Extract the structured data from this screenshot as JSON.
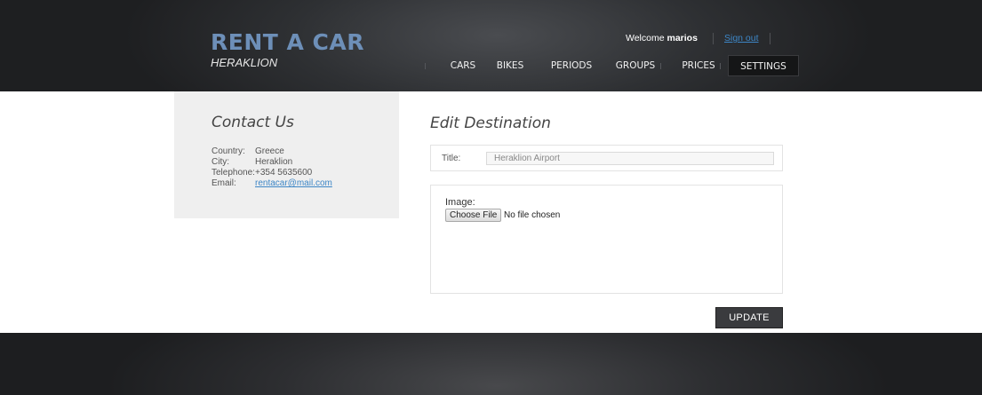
{
  "brand": {
    "title": "RENT A CAR",
    "subtitle": "HERAKLION",
    "title_color": "#6d8fb8"
  },
  "user_bar": {
    "welcome_prefix": "Welcome",
    "username": "marios",
    "signout_label": "Sign out"
  },
  "nav": {
    "items": [
      {
        "label": "CARS",
        "active": false
      },
      {
        "label": "BIKES",
        "active": false
      },
      {
        "label": "PERIODS",
        "active": false
      },
      {
        "label": "GROUPS",
        "active": false
      },
      {
        "label": "PRICES",
        "active": false
      },
      {
        "label": "SETTINGS",
        "active": true
      }
    ]
  },
  "contact": {
    "heading": "Contact Us",
    "rows": [
      {
        "label": "Country:",
        "value": "Greece"
      },
      {
        "label": "City:",
        "value": "Heraklion"
      },
      {
        "label": "Telephone:",
        "value": "+354 5635600"
      },
      {
        "label": "Email:",
        "value": "rentacar@mail.com"
      }
    ]
  },
  "form": {
    "heading": "Edit Destination",
    "title_label": "Title:",
    "title_value": "Heraklion Airport",
    "image_label": "Image:",
    "choose_file_label": "Choose File",
    "no_file_text": "No file chosen",
    "update_label": "UPDATE"
  },
  "colors": {
    "link": "#3d86c6",
    "header_bg": "#2e3033"
  }
}
